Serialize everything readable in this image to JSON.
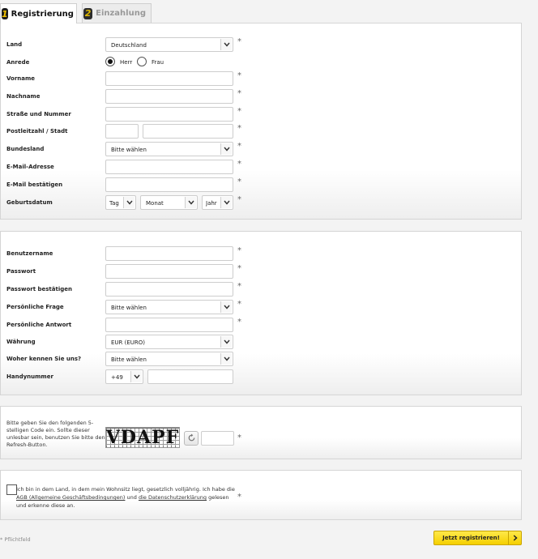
{
  "tabs": [
    {
      "number": "1",
      "label": "Registrierung",
      "active": true
    },
    {
      "number": "2",
      "label": "Einzahlung",
      "active": false
    }
  ],
  "personal": {
    "country_label": "Land",
    "country_value": "Deutschland",
    "salutation_label": "Anrede",
    "salutation_options": [
      "Herr",
      "Frau"
    ],
    "salutation_selected": "Herr",
    "firstname_label": "Vorname",
    "lastname_label": "Nachname",
    "street_label": "Straße und Nummer",
    "zip_city_label": "Postleitzahl / Stadt",
    "state_label": "Bundesland",
    "state_value": "Bitte wählen",
    "email_label": "E-Mail-Adresse",
    "email_confirm_label": "E-Mail bestätigen",
    "birthdate_label": "Geburtsdatum",
    "birth_day_value": "Tag",
    "birth_month_value": "Monat",
    "birth_year_value": "Jahr"
  },
  "account": {
    "username_label": "Benutzername",
    "password_label": "Passwort",
    "password_confirm_label": "Passwort bestätigen",
    "question_label": "Persönliche Frage",
    "question_value": "Bitte wählen",
    "answer_label": "Persönliche Antwort",
    "currency_label": "Währung",
    "currency_value": "EUR (EURO)",
    "referral_label": "Woher kennen Sie uns?",
    "referral_value": "Bitte wählen",
    "phone_label": "Handynummer",
    "phone_prefix_value": "+49"
  },
  "captcha": {
    "instructions": "Bitte geben Sie den folgenden 5-stelligen Code ein. Sollte dieser unlesbar sein, benutzen Sie bitte den Refresh-Button.",
    "code": "VDAPF"
  },
  "terms": {
    "text_before": "Ich bin in dem Land, in dem mein Wohnsitz liegt, gesetzlich volljährig. Ich habe die ",
    "agb_link": "AGB (Allgemeine Geschäftsbedingungen)",
    "text_middle": " und ",
    "privacy_link": "die Datenschutzerklärung",
    "text_after": " gelesen und erkenne diese an."
  },
  "required_marker": "*",
  "footer": {
    "required_note": "Pflichtfeld",
    "submit_label": "Jetzt registrieren!"
  },
  "icons": {
    "select_arrow": "chevron-down-icon",
    "refresh": "refresh-icon",
    "submit_arrow": "chevron-right-icon"
  },
  "colors": {
    "accent_yellow": "#f5cf00",
    "tab_number_yellow": "#f2c200",
    "panel_border": "#d5d5d5"
  }
}
